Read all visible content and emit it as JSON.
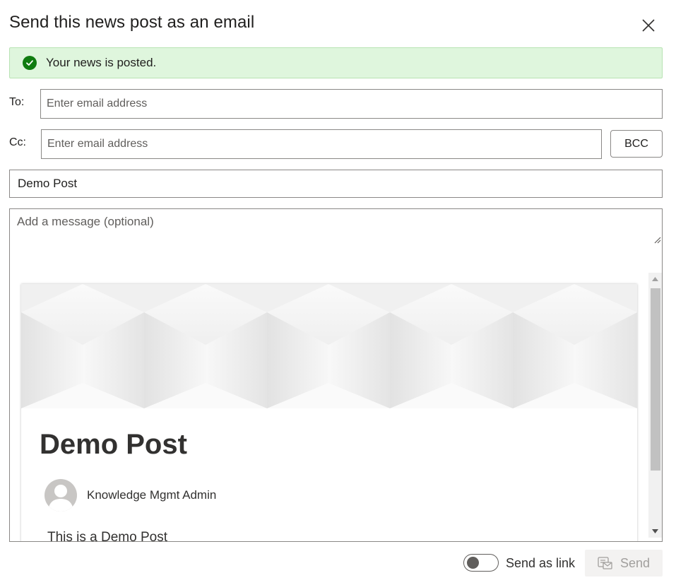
{
  "dialog": {
    "title": "Send this news post as an email",
    "close_icon": "close-icon"
  },
  "banner": {
    "message": "Your news is posted.",
    "icon": "checkmark-circle-icon",
    "status_color": "#107c10"
  },
  "to": {
    "label": "To:",
    "placeholder": "Enter email address",
    "value": ""
  },
  "cc": {
    "label": "Cc:",
    "placeholder": "Enter email address",
    "value": ""
  },
  "bcc_button": {
    "label": "BCC"
  },
  "subject": {
    "value": "Demo Post"
  },
  "message": {
    "placeholder": "Add a message (optional)",
    "value": ""
  },
  "preview": {
    "post_title": "Demo Post",
    "author": "Knowledge Mgmt Admin",
    "body_excerpt": "This is a Demo Post",
    "avatar_icon": "person-icon"
  },
  "footer": {
    "send_as_link_label": "Send as link",
    "send_as_link_on": false,
    "send_label": "Send",
    "send_icon": "send-mail-icon",
    "send_enabled": false
  }
}
